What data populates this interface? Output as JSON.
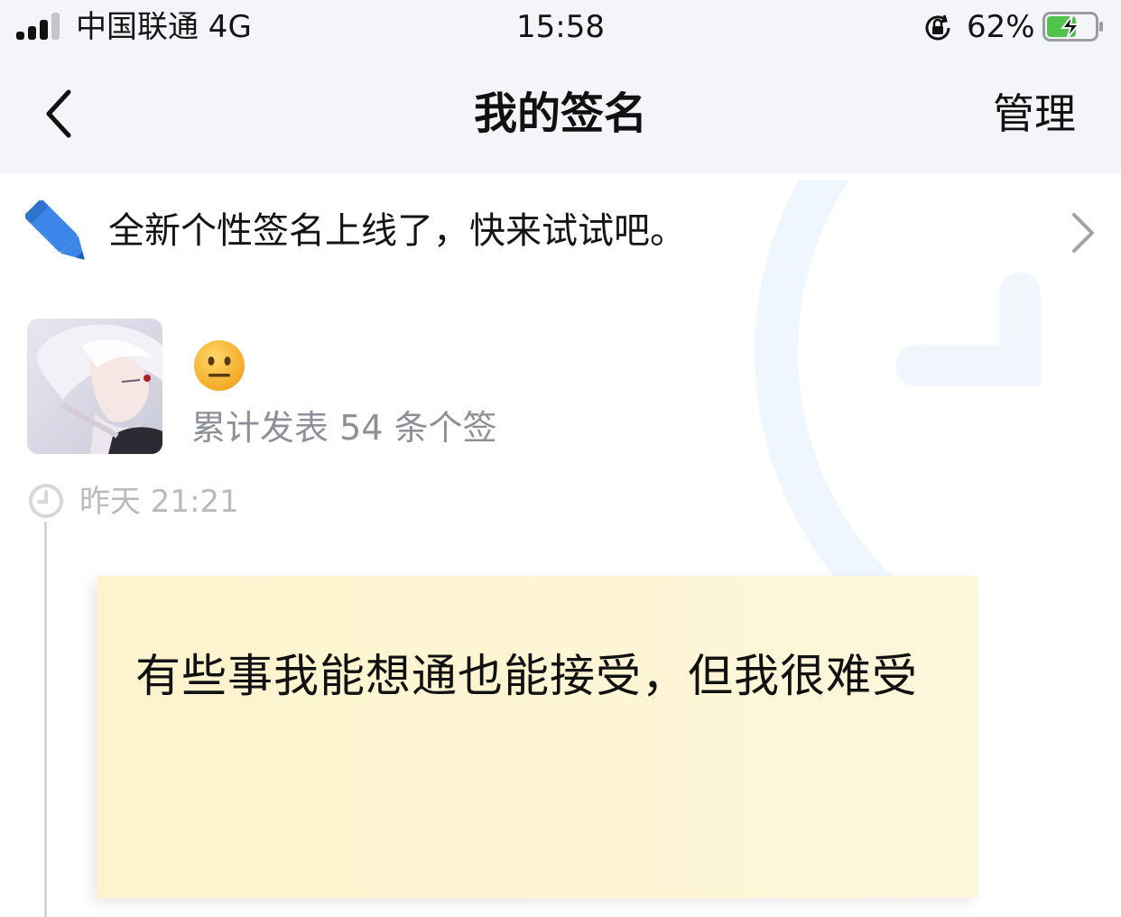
{
  "status_bar": {
    "carrier": "中国联通  4G",
    "time": "15:58",
    "battery_percent": "62%",
    "battery_level": 0.62,
    "icons": [
      "signal-icon",
      "rotation-lock-icon",
      "battery-charging-icon"
    ]
  },
  "nav": {
    "title": "我的签名",
    "manage_label": "管理",
    "back_icon": "chevron-left-icon"
  },
  "banner": {
    "text": "全新个性签名上线了，快来试试吧。",
    "icon": "pencil-icon",
    "arrow_icon": "chevron-right-icon"
  },
  "profile": {
    "emoji": "neutral-face-emoji",
    "post_count_text": "累计发表 54 条个签"
  },
  "timeline": {
    "items": [
      {
        "timestamp": "昨天 21:21",
        "text": "有些事我能想通也能接受，但我很难受"
      }
    ]
  },
  "colors": {
    "header_bg": "#f4f5f8",
    "accent_blue": "#3b86e8",
    "muted_text": "#8d9098",
    "timestamp_text": "#b8bac0",
    "note_bg": "#fdf4cd"
  }
}
